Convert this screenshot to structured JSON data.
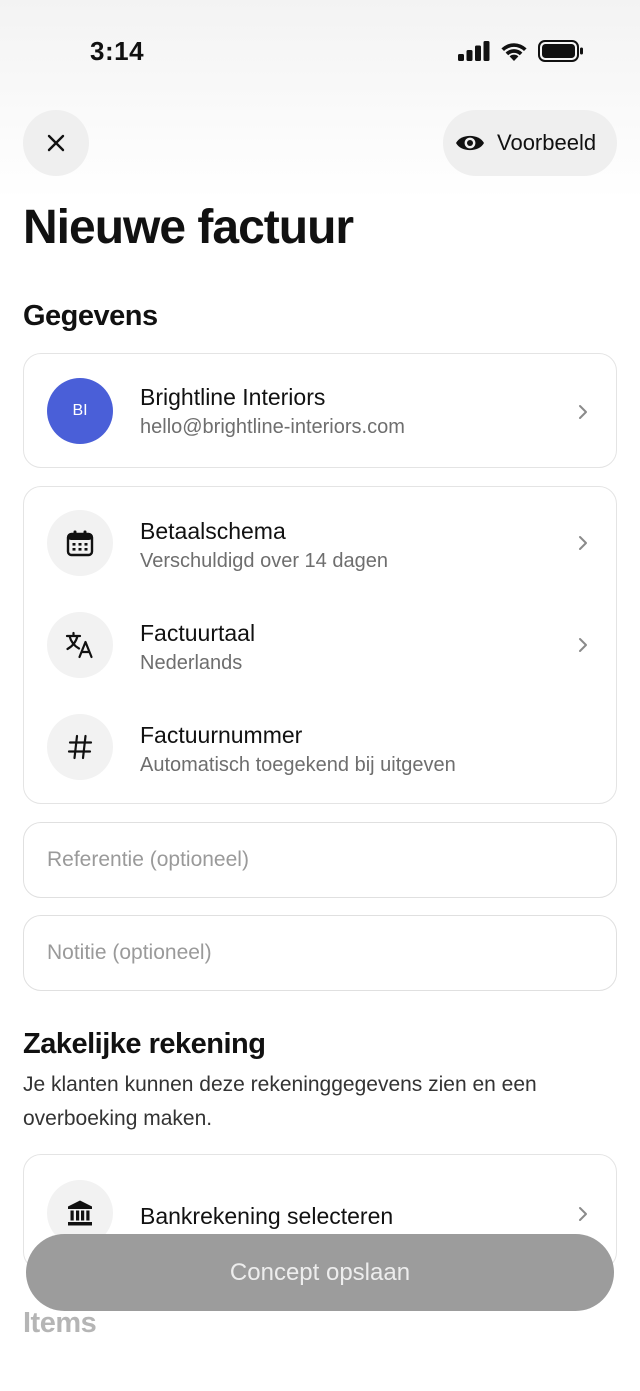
{
  "status_bar": {
    "time": "3:14"
  },
  "header": {
    "preview_label": "Voorbeeld"
  },
  "page": {
    "title": "Nieuwe factuur"
  },
  "sections": {
    "details_title": "Gegevens",
    "account_title": "Zakelijke rekening",
    "account_description": "Je klanten kunnen deze rekeninggegevens zien en een overboeking maken.",
    "items_title": "Items"
  },
  "client": {
    "initials": "BI",
    "name": "Brightline Interiors",
    "email": "hello@brightline-interiors.com",
    "avatar_color": "#4a5fd8"
  },
  "settings": [
    {
      "title": "Betaalschema",
      "subtitle": "Verschuldigd over 14 dagen",
      "icon": "calendar-icon"
    },
    {
      "title": "Factuurtaal",
      "subtitle": "Nederlands",
      "icon": "translate-icon"
    },
    {
      "title": "Factuurnummer",
      "subtitle": "Automatisch toegekend bij uitgeven",
      "icon": "hash-icon"
    }
  ],
  "fields": {
    "reference_placeholder": "Referentie (optioneel)",
    "note_placeholder": "Notitie (optioneel)"
  },
  "bank": {
    "label": "Bankrekening selecteren",
    "icon": "bank-icon"
  },
  "actions": {
    "save_draft_label": "Concept opslaan"
  }
}
